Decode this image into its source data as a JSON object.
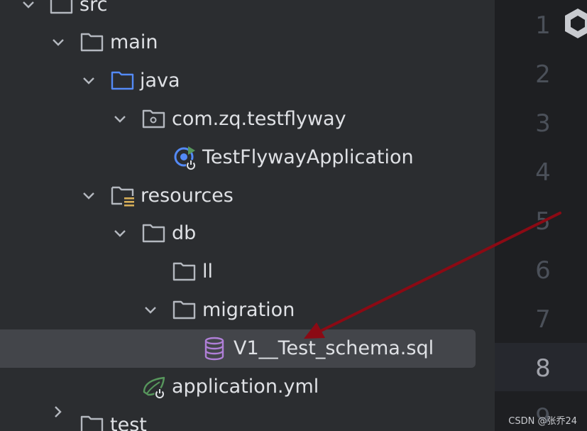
{
  "tree": {
    "items": [
      {
        "label": "src",
        "icon": "folder-icon",
        "expanded": true
      },
      {
        "label": "main",
        "icon": "folder-icon",
        "expanded": true
      },
      {
        "label": "java",
        "icon": "source-folder-icon",
        "expanded": true
      },
      {
        "label": "com.zq.testflyway",
        "icon": "package-icon",
        "expanded": true
      },
      {
        "label": "TestFlywayApplication",
        "icon": "spring-boot-run-class-icon"
      },
      {
        "label": "resources",
        "icon": "resources-folder-icon",
        "expanded": true
      },
      {
        "label": "db",
        "icon": "folder-icon",
        "expanded": true
      },
      {
        "label": "ll",
        "icon": "folder-icon"
      },
      {
        "label": "migration",
        "icon": "folder-icon",
        "expanded": true
      },
      {
        "label": "V1__Test_schema.sql",
        "icon": "database-sql-icon",
        "selected": true
      },
      {
        "label": "application.yml",
        "icon": "spring-config-icon"
      },
      {
        "label": "test",
        "icon": "folder-icon",
        "expanded": false
      }
    ]
  },
  "editor": {
    "line_numbers": [
      "1",
      "2",
      "3",
      "4",
      "5",
      "6",
      "7",
      "8",
      "9"
    ],
    "current_line": "8"
  },
  "watermark": "CSDN @张乔24",
  "colors": {
    "panel_bg": "#2B2D30",
    "editor_bg": "#1E1F22",
    "selection_bg": "#43454A",
    "text": "#DFE1E5",
    "arrow": "#8B0A14",
    "java_folder": "#548AF7",
    "db_icon": "#B07FD8"
  }
}
